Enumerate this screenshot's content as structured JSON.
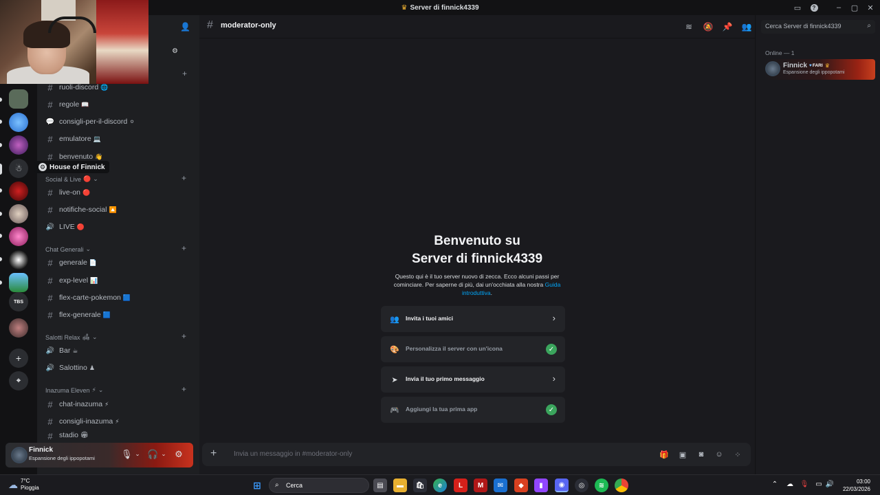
{
  "window": {
    "title": "Server di finnick4339",
    "controls": [
      "minimize",
      "maximize",
      "close"
    ]
  },
  "server_list": {
    "items": [
      {
        "name": "server-1",
        "color": "#5a6b5a"
      },
      {
        "name": "server-2",
        "color": "#2a6fd0"
      },
      {
        "name": "server-3",
        "color": "#5b2a8a"
      },
      {
        "name": "house-of-finnick",
        "color": "#3a3a3e"
      },
      {
        "name": "server-5",
        "color": "#8a1010"
      },
      {
        "name": "server-6",
        "color": "#7a7a7a"
      },
      {
        "name": "server-7",
        "color": "#c0388a"
      },
      {
        "name": "server-8",
        "color": "#1a1a1a"
      },
      {
        "name": "server-9",
        "color": "#3a8ad0"
      },
      {
        "name": "server-tbs",
        "label": "TBS",
        "color": "#2b2d31"
      },
      {
        "name": "server-11",
        "color": "#6a4a4a"
      }
    ],
    "tooltip": "House of Finnick",
    "add_label": "+",
    "discover_label": "⌖"
  },
  "sidebar": {
    "channels_top": [
      {
        "name": "ruoli-discord",
        "emoji": "🌐",
        "icon": "hash"
      },
      {
        "name": "regole",
        "emoji": "📖",
        "icon": "hash"
      },
      {
        "name": "consigli-per-il-discord",
        "emoji": "⚪",
        "icon": "forum"
      },
      {
        "name": "emulatore",
        "emoji": "💻",
        "icon": "hash"
      },
      {
        "name": "benvenuto",
        "emoji": "👋",
        "icon": "hash"
      }
    ],
    "categories": [
      {
        "name": "Social & Live",
        "emoji": "🔴",
        "channels": [
          {
            "name": "live-on",
            "emoji": "🔴",
            "icon": "hash"
          },
          {
            "name": "notifiche-social",
            "emoji": "🔼",
            "icon": "hash"
          },
          {
            "name": "LIVE",
            "emoji": "🔴",
            "icon": "speaker"
          }
        ]
      },
      {
        "name": "Chat Generali",
        "emoji": "",
        "channels": [
          {
            "name": "generale",
            "emoji": "📄",
            "icon": "hash"
          },
          {
            "name": "exp-level",
            "emoji": "📊",
            "icon": "hash"
          },
          {
            "name": "flex-carte-pokemon",
            "emoji": "🟦",
            "icon": "hash"
          },
          {
            "name": "flex-generale",
            "emoji": "🟦",
            "icon": "hash"
          }
        ]
      },
      {
        "name": "Salotti Relax",
        "emoji": "🛋",
        "channels": [
          {
            "name": "Bar",
            "emoji": "☕",
            "icon": "speaker"
          },
          {
            "name": "Salottino",
            "emoji": "♟",
            "icon": "speaker"
          }
        ]
      },
      {
        "name": "Inazuma Eleven",
        "emoji": "⚡",
        "channels": [
          {
            "name": "chat-inazuma",
            "emoji": "⚡",
            "icon": "hash"
          },
          {
            "name": "consigli-inazuma",
            "emoji": "⚡",
            "icon": "hash"
          },
          {
            "name": "stadio",
            "emoji": "🏟",
            "icon": "hash"
          }
        ]
      }
    ]
  },
  "user_panel": {
    "name": "Finnick",
    "status": "Espansione degli ippopotami"
  },
  "main": {
    "channel": "moderator-only",
    "welcome_title_1": "Benvenuto su",
    "welcome_title_2": "Server di finnick4339",
    "welcome_text": "Questo qui è il tuo server nuovo di zecca. Ecco alcuni passi per cominciare. Per saperne di più, dai un'occhiata alla nostra",
    "welcome_link": "Guida introduttiva",
    "welcome_end": ".",
    "cards": [
      {
        "label": "Invita i tuoi amici",
        "done": false,
        "icon": "invite-icon",
        "color": "#a36bd6"
      },
      {
        "label": "Personalizza il server con un'icona",
        "done": true,
        "icon": "palette-icon",
        "color": "#3ba55d"
      },
      {
        "label": "Invia il tuo primo messaggio",
        "done": false,
        "icon": "send-icon",
        "color": "#dbdee1"
      },
      {
        "label": "Aggiungi la tua prima app",
        "done": true,
        "icon": "gamepad-icon",
        "color": "#5865f2"
      }
    ],
    "composer_placeholder": "Invia un messaggio in #moderator-only"
  },
  "members": {
    "search_placeholder": "Cerca Server di finnick4339",
    "online_header": "Online — 1",
    "list": [
      {
        "name": "Finnick",
        "tag": "FARI",
        "status": "Espansione degli ippopotami"
      }
    ]
  },
  "taskbar": {
    "weather_temp": "7°C",
    "weather_desc": "Pioggia",
    "search_placeholder": "Cerca",
    "time": "03:00",
    "date": "22/03/2026"
  },
  "colors": {
    "accent": "#5865f2",
    "link": "#00a8fc",
    "success": "#3ba55d"
  }
}
